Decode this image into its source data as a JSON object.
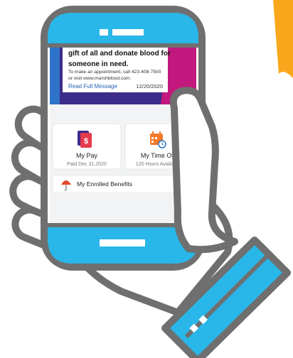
{
  "message_card": {
    "headline_line1": "gift of all and donate blood for",
    "headline_line2": "someone in need.",
    "body_line1": "To make an appointment, call 423-408-7500",
    "body_line2": "or visit www.marshblood.com.",
    "link_label": "Read Full Message",
    "date": "12/20/2020"
  },
  "tiles": {
    "pay": {
      "title": "My Pay",
      "subtitle": "Paid Dec 31,2020",
      "icon": "dollar-document-icon"
    },
    "time_off": {
      "title": "My Time Off",
      "subtitle": "120 Hours Available",
      "icon": "calendar-clock-icon"
    }
  },
  "benefits": {
    "label": "My Enrolled Benefits",
    "icon": "umbrella-icon"
  },
  "colors": {
    "outline": "#6f6f6f",
    "phone_accent": "#29b6e8",
    "screen_bg": "#f2f3f5",
    "link": "#1f63b5",
    "banner_purple": "#3b2c8a",
    "banner_magenta": "#c2187e",
    "accent_orange": "#f9a81b",
    "pay_icon_red": "#e53a4e",
    "time_icon_orange": "#f27a2a",
    "umbrella_red": "#e64a2e"
  }
}
